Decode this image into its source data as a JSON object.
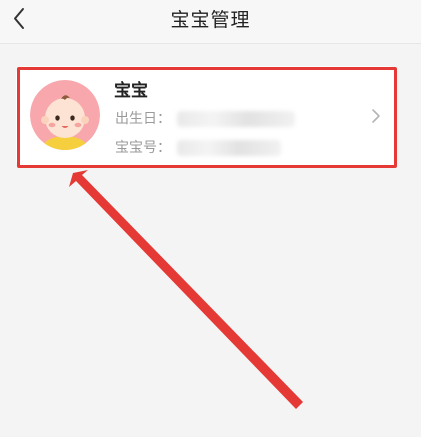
{
  "header": {
    "title": "宝宝管理"
  },
  "baby": {
    "name": "宝宝",
    "birthday_label": "出生日：",
    "id_label": "宝宝号："
  },
  "icons": {
    "back": "chevron-left-icon",
    "avatar": "baby-avatar-icon",
    "detail": "chevron-right-icon"
  },
  "colors": {
    "annotation": "#e53935",
    "avatar_bg": "#f8a8ac"
  }
}
